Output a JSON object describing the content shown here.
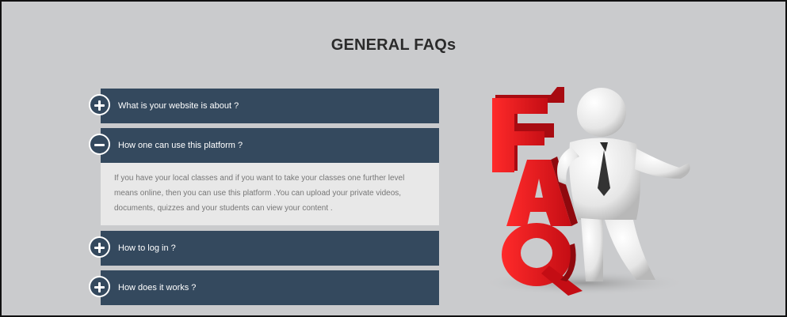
{
  "page": {
    "title": "GENERAL FAQs"
  },
  "faqs": [
    {
      "question": "What is your website is about ?",
      "state": "collapsed",
      "icon": "plus-circle-icon"
    },
    {
      "question": "How one can use this platform ?",
      "state": "expanded",
      "icon": "minus-circle-icon",
      "answer": "If you have your local classes and if you want to take your classes one further level means online, then you can use this platform .You can upload your private videos, documents, quizzes and your students can view your content ."
    },
    {
      "question": "How to log in ?",
      "state": "collapsed",
      "icon": "plus-circle-icon"
    },
    {
      "question": "How does it works ?",
      "state": "collapsed",
      "icon": "plus-circle-icon"
    }
  ],
  "illustration": {
    "letters": [
      "F",
      "A",
      "Q"
    ],
    "icon": "faq-3d-man-illustration"
  },
  "colors": {
    "header_bg": "#34495e",
    "page_bg": "#cacbcd",
    "answer_bg": "#e8e8e8",
    "faq_red": "#e0141c"
  }
}
